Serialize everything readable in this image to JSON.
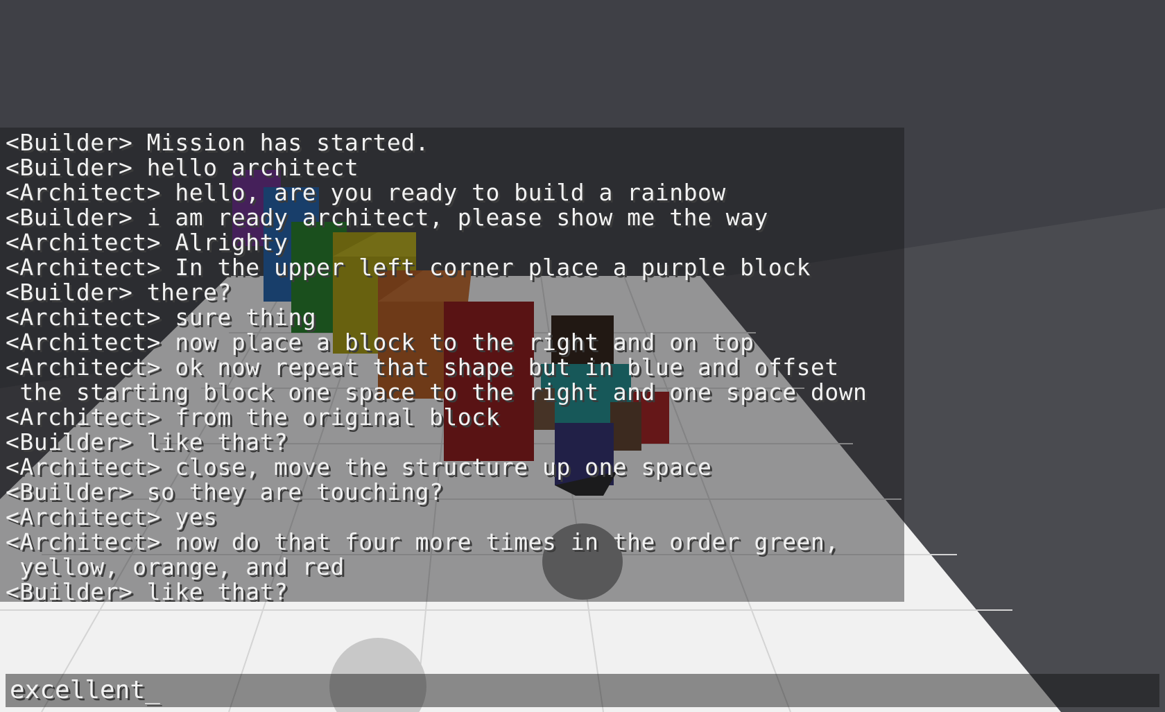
{
  "chat": {
    "lines": [
      "<Builder> Mission has started.",
      "<Builder> hello architect",
      "<Architect> hello, are you ready to build a rainbow",
      "<Builder> i am ready architect, please show me the way",
      "<Architect> Alrighty",
      "<Architect> In the upper left corner place a purple block",
      "<Builder> there?",
      "<Architect> sure thing",
      "<Architect> now place a block to the right and on top",
      "<Architect> ok now repeat that shape but in blue and offset",
      " the starting block one space to the right and one space down",
      "<Architect> from the original block",
      "<Builder> like that?",
      "<Architect> close, move the structure up one space",
      "<Builder> so they are touching?",
      "<Architect> yes",
      "<Architect> now do that four more times in the order green,",
      " yellow, orange, and red",
      "<Builder> like that?"
    ]
  },
  "input": {
    "value": "excellent",
    "cursor": "_"
  },
  "colors": {
    "sky": "#3f4046",
    "floor_light": "#f4f4f4",
    "purple": "#6a2a8c",
    "blue": "#1d5ea8",
    "green": "#1f7a24",
    "yellow": "#a59a0c",
    "orange": "#b0561b",
    "red": "#8c1414"
  }
}
